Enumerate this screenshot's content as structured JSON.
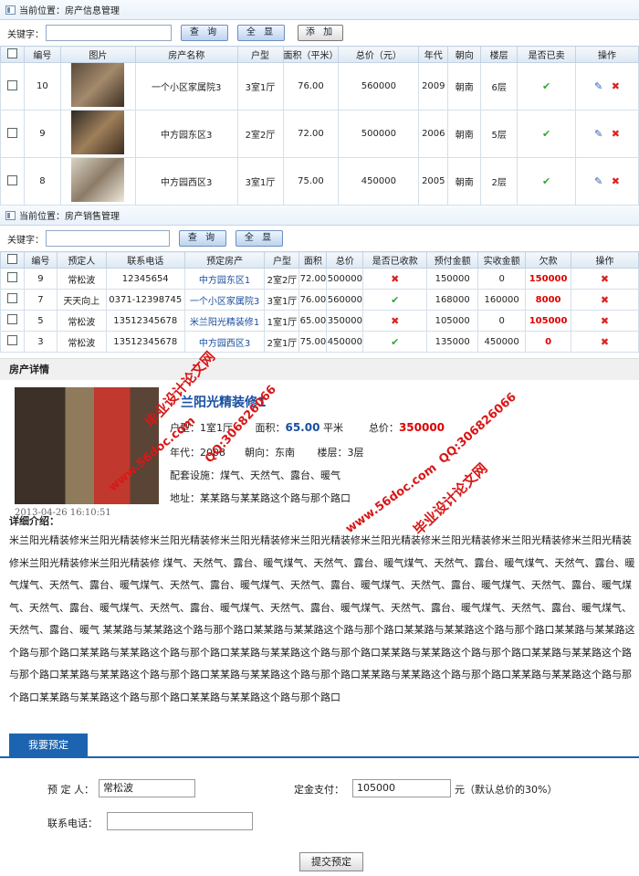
{
  "info": {
    "crumb": "当前位置：房产信息管理",
    "keyword_label": "关键字：",
    "search": "查 询",
    "show_all": "全 显",
    "add": "添 加",
    "headers": [
      "编号",
      "图片",
      "房产名称",
      "户型",
      "面积（平米）",
      "总价（元）",
      "年代",
      "朝向",
      "楼层",
      "是否已卖",
      "操作"
    ],
    "rows": [
      {
        "id": "10",
        "name": "一个小区家属院3",
        "layout": "3室1厅",
        "area": "76.00",
        "price": "560000",
        "year": "2009",
        "dir": "朝南",
        "floor": "6层"
      },
      {
        "id": "9",
        "name": "中方园东区3",
        "layout": "2室2厅",
        "area": "72.00",
        "price": "500000",
        "year": "2006",
        "dir": "朝南",
        "floor": "5层"
      },
      {
        "id": "8",
        "name": "中方园西区3",
        "layout": "3室1厅",
        "area": "75.00",
        "price": "450000",
        "year": "2005",
        "dir": "朝南",
        "floor": "2层"
      }
    ]
  },
  "sales": {
    "crumb": "当前位置：房产销售管理",
    "keyword_label": "关键字：",
    "search": "查 询",
    "show_all": "全 显",
    "headers": [
      "编号",
      "预定人",
      "联系电话",
      "预定房产",
      "户型",
      "面积",
      "总价",
      "是否已收款",
      "预付金额",
      "实收金额",
      "欠款",
      "操作"
    ],
    "rows": [
      {
        "id": "9",
        "person": "常松波",
        "phone": "12345654",
        "house": "中方园东区1",
        "layout": "2室2厅",
        "area": "72.00",
        "price": "500000",
        "paid": false,
        "prepay": "150000",
        "actual": "0",
        "owe": "150000"
      },
      {
        "id": "7",
        "person": "天天向上",
        "phone": "0371-12398745",
        "house": "一个小区家属院3",
        "layout": "3室1厅",
        "area": "76.00",
        "price": "560000",
        "paid": true,
        "prepay": "168000",
        "actual": "160000",
        "owe": "8000"
      },
      {
        "id": "5",
        "person": "常松波",
        "phone": "13512345678",
        "house": "米兰阳光精装修1",
        "layout": "1室1厅",
        "area": "65.00",
        "price": "350000",
        "paid": false,
        "prepay": "105000",
        "actual": "0",
        "owe": "105000"
      },
      {
        "id": "3",
        "person": "常松波",
        "phone": "13512345678",
        "house": "中方园西区3",
        "layout": "2室1厅",
        "area": "75.00",
        "price": "450000",
        "paid": true,
        "prepay": "135000",
        "actual": "450000",
        "owe": "0"
      }
    ]
  },
  "detail": {
    "section_title": "房产详情",
    "name": "兰阳光精装修1",
    "layout_label": "户型：",
    "layout": "1室1厅",
    "area_label": "面积：",
    "area": "65.00",
    "area_unit": "平米",
    "price_label": "总价：",
    "price": "350000",
    "year": "年代：2008",
    "direction": "朝向：东南",
    "floor": "楼层：3层",
    "facilities": "配套设施：煤气、天然气、露台、暖气",
    "address": "地址：某某路与某某路这个路与那个路口",
    "timestamp": "2013-04-26 16:10:51",
    "intro_title": "详细介绍：",
    "intro_text": "米兰阳光精装修米兰阳光精装修米兰阳光精装修米兰阳光精装修米兰阳光精装修米兰阳光精装修米兰阳光精装修米兰阳光精装修米兰阳光精装修米兰阳光精装修米兰阳光精装修 煤气、天然气、露台、暖气煤气、天然气、露台、暖气煤气、天然气、露台、暖气煤气、天然气、露台、暖气煤气、天然气、露台、暖气煤气、天然气、露台、暖气煤气、天然气、露台、暖气煤气、天然气、露台、暖气煤气、天然气、露台、暖气煤气、天然气、露台、暖气煤气、天然气、露台、暖气煤气、天然气、露台、暖气煤气、天然气、露台、暖气煤气、天然气、露台、暖气煤气、天然气、露台、暖气 某某路与某某路这个路与那个路口某某路与某某路这个路与那个路口某某路与某某路这个路与那个路口某某路与某某路这个路与那个路口某某路与某某路这个路与那个路口某某路与某某路这个路与那个路口某某路与某某路这个路与那个路口某某路与某某路这个路与那个路口某某路与某某路这个路与那个路口某某路与某某路这个路与那个路口某某路与某某路这个路与那个路口某某路与某某路这个路与那个路口某某路与某某路这个路与那个路口某某路与某某路这个路与那个路口"
  },
  "booking": {
    "tab": "我要预定",
    "person_label": "预 定 人：",
    "person_value": "常松波",
    "deposit_label": "定金支付：",
    "deposit_value": "105000",
    "deposit_note": "元（默认总价的30%）",
    "phone_label": "联系电话：",
    "phone_value": "",
    "submit": "提交预定"
  },
  "watermark": {
    "site": "毕业设计论文网",
    "url": "www.56doc.com",
    "qq": "QQ:306826066"
  },
  "colors": {
    "accent": "#1d64b0",
    "alert": "#dd0000",
    "ok": "#3aa23a"
  }
}
